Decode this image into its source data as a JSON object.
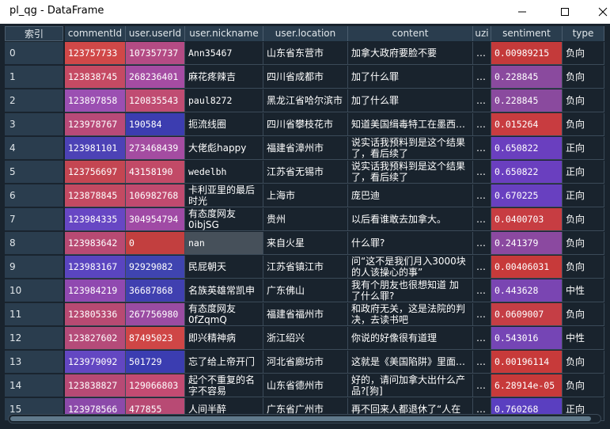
{
  "window": {
    "title": "pl_qg - DataFrame"
  },
  "columns": [
    "索引",
    "commentId",
    "user.userId",
    "user.nickname",
    "user.location",
    "content",
    "uzi",
    "sentiment",
    "type"
  ],
  "rows": [
    {
      "index": "0",
      "commentId": "123757733",
      "userId": "107357737",
      "nickname": "Ann35467",
      "location": "山东省东营市",
      "content": "加拿大政府要脸不要",
      "uzi": "…",
      "sentiment": "0.00989215",
      "type": "负向"
    },
    {
      "index": "1",
      "commentId": "123838745",
      "userId": "268236401",
      "nickname": "麻花疼辣吉",
      "location": "四川省成都市",
      "content": "加了什么罪",
      "uzi": "…",
      "sentiment": "0.228845",
      "type": "负向"
    },
    {
      "index": "2",
      "commentId": "123897858",
      "userId": "120835543",
      "nickname": "paul8272",
      "location": "黑龙江省哈尔滨市",
      "content": "加了什么罪",
      "uzi": "…",
      "sentiment": "0.228845",
      "type": "负向"
    },
    {
      "index": "3",
      "commentId": "123978767",
      "userId": "190584",
      "nickname": "扼流线圈",
      "location": "四川省攀枝花市",
      "content": "知道美国缉毒特工在墨西…",
      "uzi": "…",
      "sentiment": "0.015264",
      "type": "负向"
    },
    {
      "index": "4",
      "commentId": "123981101",
      "userId": "273468439",
      "nickname": "大佬彪happy",
      "location": "福建省漳州市",
      "content": "说实话我预料到是这个结果\n了，看后续了",
      "uzi": "…",
      "sentiment": "0.650822",
      "type": "正向"
    },
    {
      "index": "5",
      "commentId": "123756697",
      "userId": "43158190",
      "nickname": "wedelbh",
      "location": "江苏省无锡市",
      "content": "说实话我预料到是这个结果\n了，看后续了",
      "uzi": "…",
      "sentiment": "0.650822",
      "type": "正向"
    },
    {
      "index": "6",
      "commentId": "123878845",
      "userId": "106982768",
      "nickname": "卡利亚里的最后\n时光",
      "location": "上海市",
      "content": "庞巴迪",
      "uzi": "…",
      "sentiment": "0.670225",
      "type": "正向"
    },
    {
      "index": "7",
      "commentId": "123984335",
      "userId": "304954794",
      "nickname": "有态度网友\n0ibjSG",
      "location": "贵州",
      "content": "以后看谁敢去加拿大。",
      "uzi": "…",
      "sentiment": "0.0400703",
      "type": "负向"
    },
    {
      "index": "8",
      "commentId": "123983642",
      "userId": "0",
      "nickname": "nan",
      "location": "来自火星",
      "content": "什么罪?",
      "uzi": "…",
      "sentiment": "0.241379",
      "type": "负向"
    },
    {
      "index": "9",
      "commentId": "123983167",
      "userId": "92929082",
      "nickname": "民屁朝天",
      "location": "江苏省镇江市",
      "content": "问“这不是我们月入3000块\n的人该操心的事”",
      "uzi": "…",
      "sentiment": "0.00406031",
      "type": "负向"
    },
    {
      "index": "10",
      "commentId": "123984219",
      "userId": "36687868",
      "nickname": "名族英雄常凯申",
      "location": "广东佛山",
      "content": "我有个朋友也很想知道 加\n了什么罪?",
      "uzi": "…",
      "sentiment": "0.443628",
      "type": "中性"
    },
    {
      "index": "11",
      "commentId": "123805336",
      "userId": "267756980",
      "nickname": "有态度网友\n0fZqmQ",
      "location": "福建省福州市",
      "content": "和政府无关，这是法院的判\n决，去读书吧",
      "uzi": "…",
      "sentiment": "0.0609007",
      "type": "负向"
    },
    {
      "index": "12",
      "commentId": "123827602",
      "userId": "87495023",
      "nickname": "即兴精神病",
      "location": "浙江绍兴",
      "content": "你说的好像很有道理",
      "uzi": "…",
      "sentiment": "0.543016",
      "type": "中性"
    },
    {
      "index": "13",
      "commentId": "123979092",
      "userId": "501729",
      "nickname": "忘了给上帝开门",
      "location": "河北省廊坊市",
      "content": "这就是《美国陷阱》里面…",
      "uzi": "…",
      "sentiment": "0.00196114",
      "type": "负向"
    },
    {
      "index": "14",
      "commentId": "123838827",
      "userId": "129066803",
      "nickname": "起个不重复的名\n字不容易",
      "location": "山东省德州市",
      "content": "好的，请问加拿大出什么产\n品?[狗]",
      "uzi": "…",
      "sentiment": "6.28914e-05",
      "type": "负向"
    },
    {
      "index": "15",
      "commentId": "123978566",
      "userId": "477855",
      "nickname": "人间半醉",
      "location": "广东省广州市",
      "content": "再不回来人都退休了“人在",
      "uzi": "…",
      "sentiment": "0.760268",
      "type": "正向"
    }
  ],
  "cell_colors": {
    "commentId": [
      "#d04848",
      "#c54a63",
      "#9b4fb2",
      "#b84a78",
      "#4c42b6",
      "#c44652",
      "#c34a62",
      "#6747c4",
      "#b84a73",
      "#5a45c0",
      "#9049b0",
      "#b84a72",
      "#b54b79",
      "#6347c2",
      "#b74a75",
      "#8c4aaa"
    ],
    "userId": [
      "#b44b84",
      "#a54ca3",
      "#c04c72",
      "#3c3db0",
      "#a44ca1",
      "#c24a67",
      "#c04a6f",
      "#a04aa5",
      "#c23f3f",
      "#3f44b0",
      "#4040b0",
      "#9a4ca2",
      "#cf4646",
      "#3b3db1",
      "#c34b72",
      "#b84a74"
    ],
    "sentiment": [
      "#c43a3a",
      "#8a4a9e",
      "#8a4a9e",
      "#c83c40",
      "#6a3fbf",
      "#6a3fbf",
      "#6840c0",
      "#c73d42",
      "#8b49a0",
      "#c73a3a",
      "#7a45b2",
      "#c53e45",
      "#7545b5",
      "#c73a3a",
      "#c73a3a",
      "#5a3fc0"
    ]
  }
}
